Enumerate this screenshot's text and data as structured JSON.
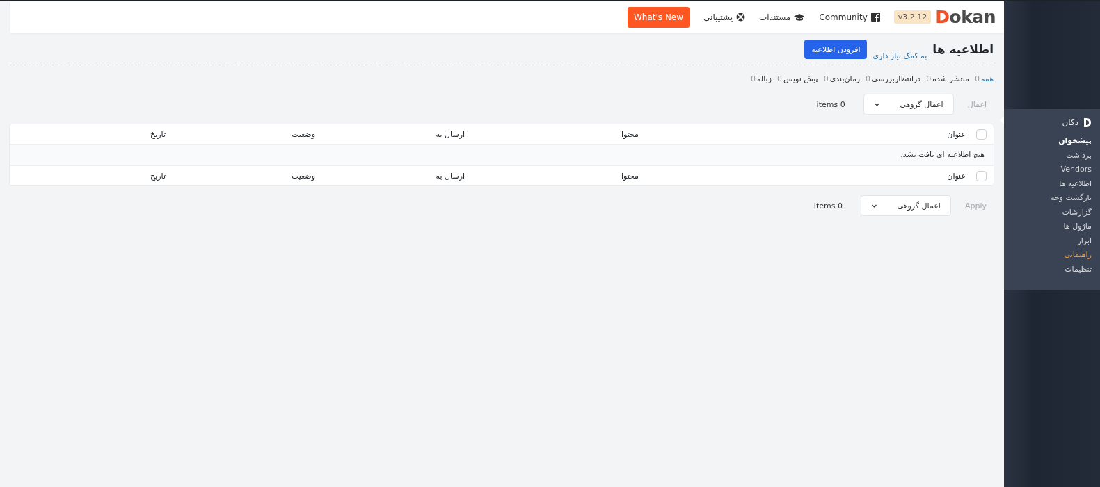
{
  "header": {
    "logo": "Dokan",
    "version": "v3.2.12",
    "links": [
      {
        "kind": "facebook",
        "label": "Community"
      },
      {
        "kind": "docs",
        "label": "مستندات"
      },
      {
        "kind": "support",
        "label": "پشتیبانی"
      }
    ],
    "whats_new": "What's New"
  },
  "page": {
    "title": "اطلاعیه ها",
    "help_link": "به کمک نیاز داری",
    "add_button": "افزودن اطلاعیه"
  },
  "filters": [
    {
      "label": "همه",
      "count": "0",
      "selected": true
    },
    {
      "label": "منتشر شده",
      "count": "0",
      "selected": false
    },
    {
      "label": "درانتظاربررسی",
      "count": "0",
      "selected": false
    },
    {
      "label": "زمان‌بندی",
      "count": "0",
      "selected": false
    },
    {
      "label": "پیش نویس",
      "count": "0",
      "selected": false
    },
    {
      "label": "زباله",
      "count": "0",
      "selected": false
    }
  ],
  "bulk_top": {
    "apply": "اعمال",
    "disabled": true,
    "select": "اعمال گروهی",
    "count": "items 0"
  },
  "table": {
    "header_columns": [
      "عنوان",
      "محتوا",
      "ارسال به",
      "وضعیت",
      "تاریخ"
    ],
    "header_checked": false,
    "empty_message": "هیچ اطلاعیه ای یافت نشد.",
    "footer_columns": [
      "عنوان",
      "محتوا",
      "ارسال به",
      "وضعیت",
      "تاریخ"
    ],
    "footer_checked": false
  },
  "bulk_bottom": {
    "apply": "Apply",
    "disabled": true,
    "select": "اعمال گروهی",
    "count": "items 0"
  },
  "menu": {
    "title": "دکان",
    "items": [
      {
        "label": "پیشخوان",
        "selected": true,
        "highlighted": false
      },
      {
        "label": "برداشت",
        "selected": false,
        "highlighted": false
      },
      {
        "label": "Vendors",
        "selected": false,
        "highlighted": false
      },
      {
        "label": "اطلاعیه ها",
        "selected": false,
        "highlighted": false
      },
      {
        "label": "بازگشت وجه",
        "selected": false,
        "highlighted": false
      },
      {
        "label": "گزارشات",
        "selected": false,
        "highlighted": false
      },
      {
        "label": "ماژول ها",
        "selected": false,
        "highlighted": false
      },
      {
        "label": "ابزار",
        "selected": false,
        "highlighted": false
      },
      {
        "label": "راهنمایی",
        "selected": false,
        "highlighted": true
      },
      {
        "label": "تنظیمات",
        "selected": false,
        "highlighted": false
      }
    ]
  }
}
